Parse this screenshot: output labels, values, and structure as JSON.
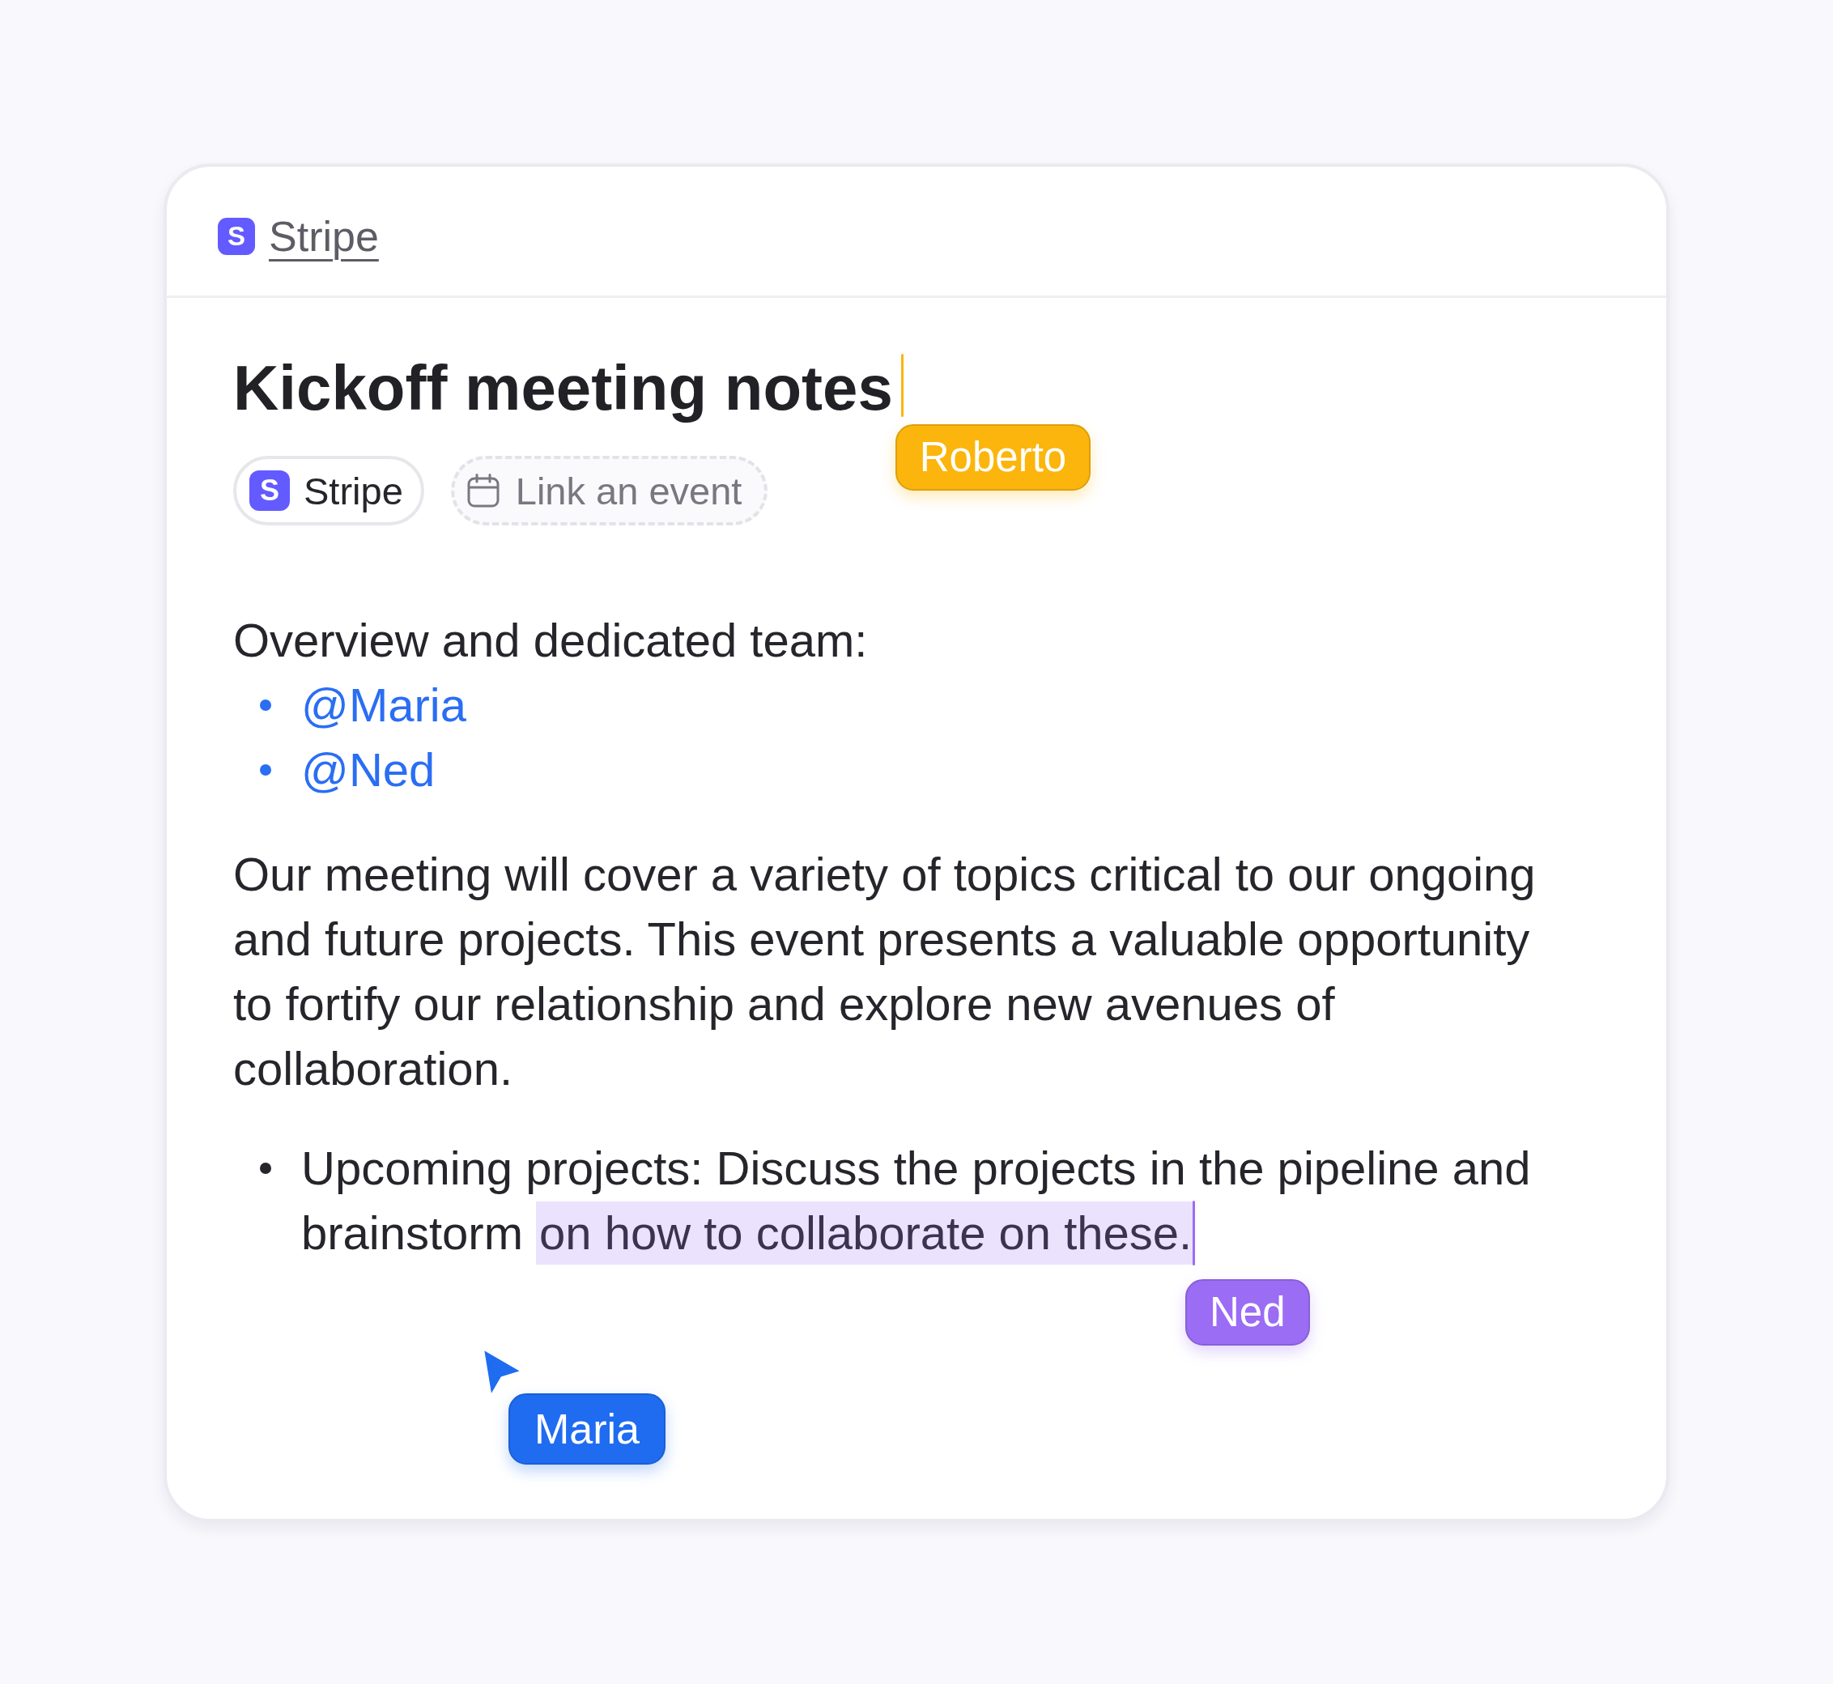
{
  "header": {
    "workspace": {
      "logo": "S",
      "label": "Stripe"
    }
  },
  "document": {
    "title": {
      "text": "Kickoff meeting notes",
      "cursor": {
        "name": "Roberto",
        "color": "#fbb50c"
      }
    },
    "chips": [
      {
        "kind": "company",
        "logo": "S",
        "label": "Stripe"
      },
      {
        "kind": "event",
        "label": "Link an event"
      }
    ],
    "blocks": [
      {
        "kind": "paragraph",
        "text": "Overview and dedicated team:"
      },
      {
        "kind": "mentions",
        "items": [
          "@Maria",
          "@Ned"
        ]
      },
      {
        "kind": "paragraph",
        "text": "Our meeting will cover a variety of topics critical to our ongoing and future projects. This event presents a valuable opportunity to fortify our relationship and explore new avenues of collaboration."
      },
      {
        "kind": "bullets",
        "items": [
          {
            "text": "Upcoming projects: Discuss the projects in the pipeline and brainstorm",
            "selected_text": "on how to collaborate on these.",
            "cursor": {
              "name": "Ned",
              "color": "#9b6cf4"
            }
          }
        ]
      }
    ]
  },
  "pointer": {
    "name": "Maria",
    "color": "#1f6cf1"
  }
}
